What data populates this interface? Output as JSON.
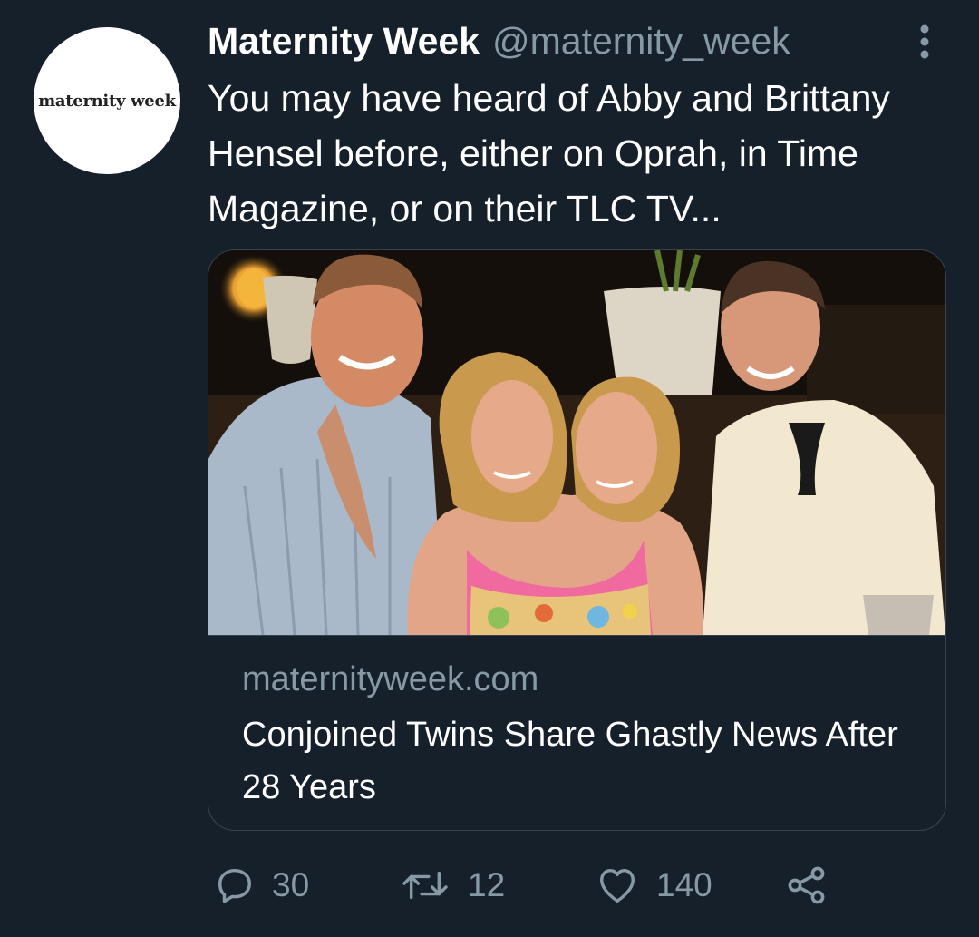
{
  "author": {
    "avatar_text": "maternity week",
    "display_name": "Maternity Week",
    "handle": "@maternity_week"
  },
  "tweet": {
    "text": "You may have heard of Abby and Brittany Hensel before, either on Oprah, in Time Magazine, or on their TLC TV..."
  },
  "card": {
    "domain": "maternityweek.com",
    "title": "Conjoined Twins Share Ghastly News After 28 Years",
    "image_alt": "Photo of conjoined twins with two smiling men at a dinner setting"
  },
  "actions": {
    "reply_count": "30",
    "retweet_count": "12",
    "like_count": "140"
  },
  "colors": {
    "background": "#15202b",
    "secondary_text": "#8899a6",
    "border": "#38444d",
    "primary_text": "#ffffff"
  },
  "icons": {
    "more": "more-vertical-icon",
    "reply": "reply-icon",
    "retweet": "retweet-icon",
    "like": "heart-icon",
    "share": "share-icon"
  }
}
